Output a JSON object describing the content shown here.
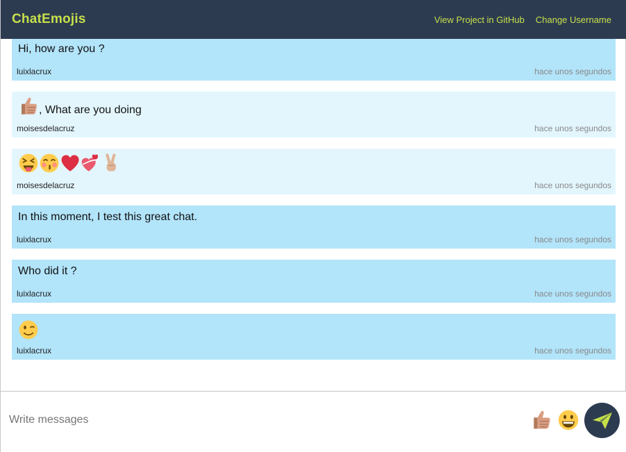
{
  "header": {
    "brand": "ChatEmojis",
    "links": [
      "View Project in GitHub",
      "Change Username"
    ]
  },
  "messages": [
    {
      "text": "Hi, how are you ?",
      "emojis": [],
      "user": "luixlacrux",
      "time": "hace unos segundos",
      "own": true
    },
    {
      "text": ", What are you doing",
      "emojis": [
        "thumbs-up-icon"
      ],
      "user": "moisesdelacruz",
      "time": "hace unos segundos",
      "own": false
    },
    {
      "text": "",
      "emojis": [
        "squinting-tongue-face-icon",
        "kissing-blushing-face-icon",
        "red-heart-icon",
        "heart-with-ribbon-icon",
        "victory-hand-icon"
      ],
      "user": "moisesdelacruz",
      "time": "hace unos segundos",
      "own": false
    },
    {
      "text": "In this moment, I test this great chat.",
      "emojis": [],
      "user": "luixlacrux",
      "time": "hace unos segundos",
      "own": true
    },
    {
      "text": "Who did it ?",
      "emojis": [],
      "user": "luixlacrux",
      "time": "hace unos segundos",
      "own": true
    },
    {
      "text": "",
      "emojis": [
        "winking-face-icon"
      ],
      "user": "luixlacrux",
      "time": "hace unos segundos",
      "own": true
    }
  ],
  "composer": {
    "placeholder": "Write messages",
    "value": "",
    "quick_emojis": [
      "thumbs-up-icon",
      "grinning-face-icon"
    ],
    "send_icon": "send-plane-icon"
  },
  "colors": {
    "navbar": "#2d3b51",
    "brand": "#c6e04a",
    "own_message": "#b2e4fa",
    "other_message": "#e3f6fd"
  }
}
